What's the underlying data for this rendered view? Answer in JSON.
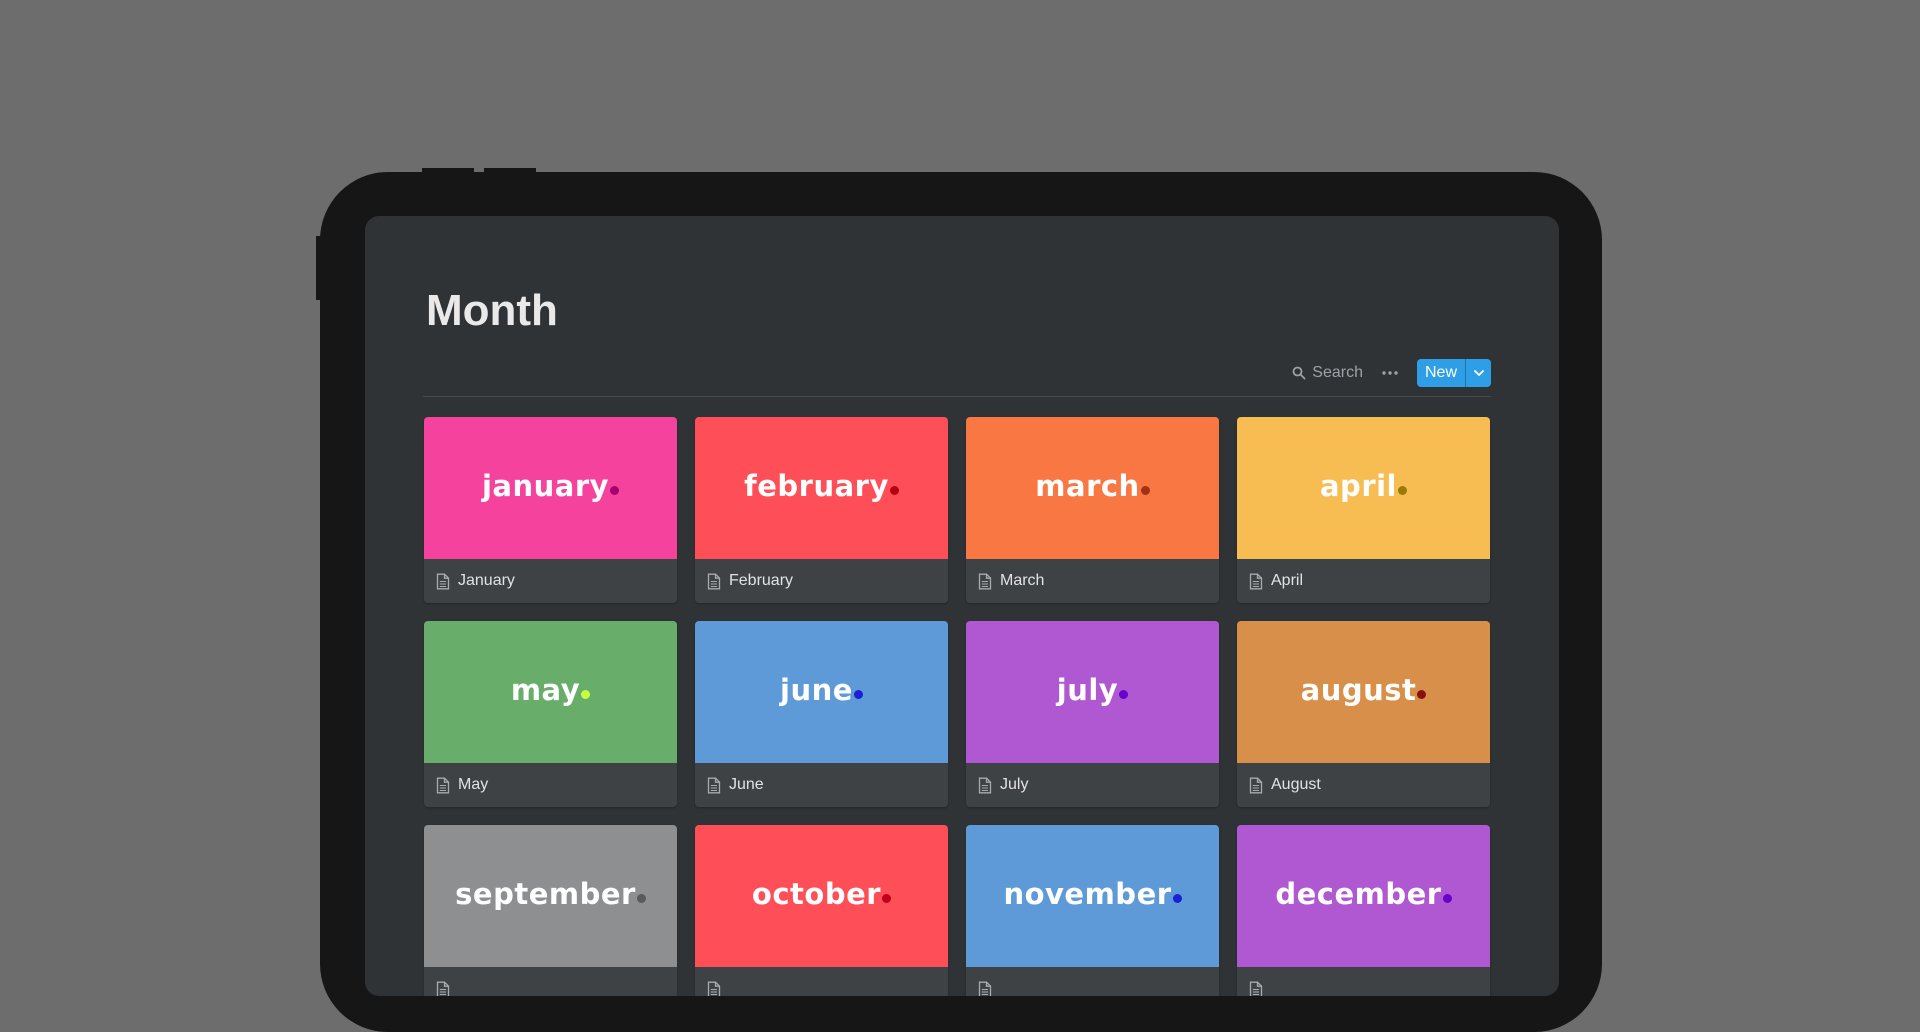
{
  "page": {
    "title": "Month"
  },
  "toolbar": {
    "search_label": "Search",
    "more_icon": "ellipsis-icon",
    "new_label": "New",
    "new_menu_icon": "chevron-down-icon"
  },
  "colors": {
    "accent": "#2e9fe6",
    "background": "#6d6d6d",
    "device": "#161616",
    "screen": "#2f3336",
    "card": "#3e4245"
  },
  "cards": [
    {
      "cover_text": "january",
      "label": "January",
      "cover_color": "#f5429c",
      "dot_color": "#a3006d",
      "icon": "page-icon"
    },
    {
      "cover_text": "february",
      "label": "February",
      "cover_color": "#fe4e58",
      "dot_color": "#b50016",
      "icon": "page-icon"
    },
    {
      "cover_text": "march",
      "label": "March",
      "cover_color": "#f97743",
      "dot_color": "#9f3212",
      "icon": "page-icon"
    },
    {
      "cover_text": "april",
      "label": "April",
      "cover_color": "#f7bc52",
      "dot_color": "#9a7a06",
      "icon": "page-icon"
    },
    {
      "cover_text": "may",
      "label": "May",
      "cover_color": "#68ad6a",
      "dot_color": "#c6ff3e",
      "icon": "page-icon"
    },
    {
      "cover_text": "june",
      "label": "June",
      "cover_color": "#5e9ad8",
      "dot_color": "#1b1fd6",
      "icon": "page-icon"
    },
    {
      "cover_text": "july",
      "label": "July",
      "cover_color": "#b057d2",
      "dot_color": "#6a00cc",
      "icon": "page-icon"
    },
    {
      "cover_text": "august",
      "label": "August",
      "cover_color": "#d88f4a",
      "dot_color": "#8a1010",
      "icon": "page-icon"
    },
    {
      "cover_text": "september",
      "label": "",
      "cover_color": "#8e8f91",
      "dot_color": "#5a5a5a",
      "icon": "page-icon"
    },
    {
      "cover_text": "october",
      "label": "",
      "cover_color": "#fe4e58",
      "dot_color": "#c0001b",
      "icon": "page-icon"
    },
    {
      "cover_text": "november",
      "label": "",
      "cover_color": "#5e9ad8",
      "dot_color": "#1b1fd6",
      "icon": "page-icon"
    },
    {
      "cover_text": "december",
      "label": "",
      "cover_color": "#b057d2",
      "dot_color": "#6a00cc",
      "icon": "page-icon"
    }
  ]
}
